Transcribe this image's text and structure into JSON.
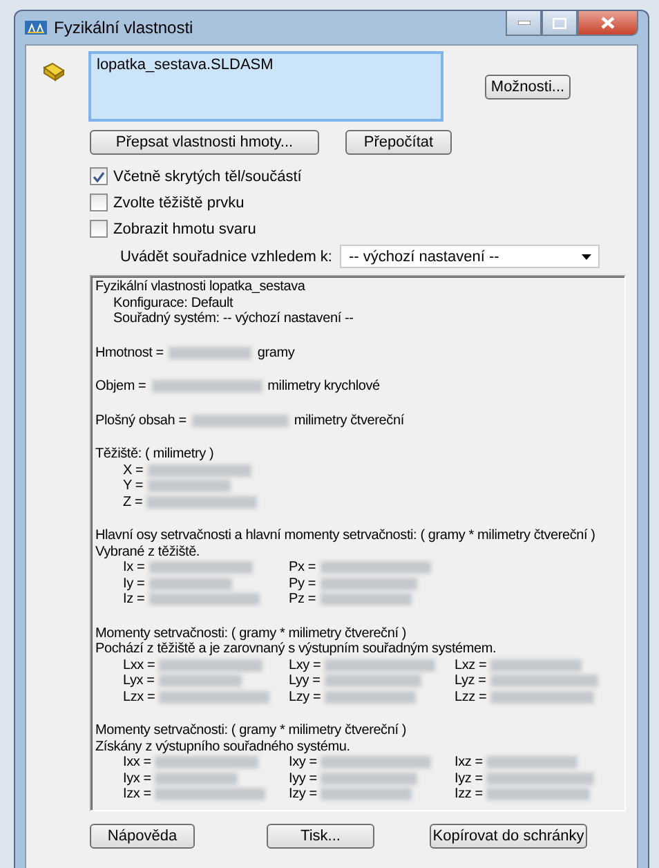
{
  "window": {
    "title": "Fyzikální vlastnosti"
  },
  "selection": {
    "items": [
      "lopatka_sestava.SLDASM"
    ]
  },
  "buttons": {
    "options": "Možnosti...",
    "override": "Přepsat vlastnosti hmoty...",
    "recalculate": "Přepočítat"
  },
  "checkboxes": [
    {
      "label": "Včetně skrytých těl/součástí",
      "checked": true
    },
    {
      "label": "Zvolte těžiště prvku",
      "checked": false
    },
    {
      "label": "Zobrazit hmotu svaru",
      "checked": false
    }
  ],
  "coordinate_system": {
    "label": "Uvádět souřadnice vzhledem k:",
    "value": "-- výchozí nastavení --"
  },
  "results": [
    {
      "kind": "text",
      "text": "Fyzikální vlastnosti lopatka_sestava",
      "children": [
        {
          "text": "Konfigurace: Default"
        },
        {
          "text": "Souřadný systém: -- výchozí nastavení --"
        }
      ]
    },
    {
      "kind": "value",
      "label": "Hmotnost =",
      "unit": "gramy"
    },
    {
      "kind": "value",
      "label": "Objem =",
      "unit": "milimetry krychlové"
    },
    {
      "kind": "value",
      "label": "Plošný obsah =",
      "unit": "milimetry čtvereční"
    },
    {
      "kind": "grid",
      "lines": [
        "Těžiště: ( milimetry )"
      ],
      "rows": [
        [
          "X ="
        ],
        [
          "Y ="
        ],
        [
          "Z ="
        ]
      ]
    },
    {
      "kind": "grid",
      "lines": [
        "Hlavní osy setrvačnosti a hlavní momenty setrvačnosti: ( gramy *  milimetry čtvereční )",
        "Vybrané z těžiště."
      ],
      "rows": [
        [
          "Ix =",
          "Px ="
        ],
        [
          "Iy =",
          "Py ="
        ],
        [
          "Iz =",
          "Pz ="
        ]
      ]
    },
    {
      "kind": "grid",
      "lines": [
        "Momenty setrvačnosti: ( gramy *  milimetry čtvereční )",
        "Pochází z těžiště a je zarovnaný s výstupním souřadným systémem."
      ],
      "rows": [
        [
          "Lxx =",
          "Lxy =",
          "Lxz ="
        ],
        [
          "Lyx =",
          "Lyy =",
          "Lyz ="
        ],
        [
          "Lzx =",
          "Lzy =",
          "Lzz ="
        ]
      ]
    },
    {
      "kind": "grid",
      "lines": [
        "Momenty setrvačnosti: ( gramy *  milimetry čtvereční )",
        "Získány z výstupního souřadného systému."
      ],
      "rows": [
        [
          "Ixx =",
          "Ixy =",
          "Ixz ="
        ],
        [
          "Iyx =",
          "Iyy =",
          "Iyz ="
        ],
        [
          "Izx =",
          "Izy =",
          "Izz ="
        ]
      ]
    }
  ],
  "footer_buttons": [
    "Nápověda",
    "Tisk...",
    "Kopírovat do schránky"
  ]
}
